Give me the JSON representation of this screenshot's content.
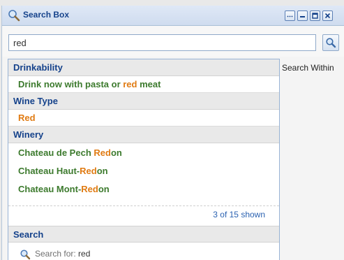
{
  "panel": {
    "title": "Search Box",
    "buttons": [
      "more",
      "minimize",
      "maximize",
      "close"
    ]
  },
  "search": {
    "value": "red",
    "button_icon": "search-icon"
  },
  "side_label": "Search Within",
  "dropdown": {
    "groups": [
      {
        "header": "Drinkability",
        "items": [
          {
            "pre": "Drink now with pasta or ",
            "match": "red",
            "post": " meat"
          }
        ]
      },
      {
        "header": "Wine Type",
        "items": [
          {
            "pre": "",
            "match": "Red",
            "post": ""
          }
        ]
      },
      {
        "header": "Winery",
        "items": [
          {
            "pre": "Chateau de Pech ",
            "match": "Red",
            "post": "on"
          },
          {
            "pre": "Chateau Haut-",
            "match": "Red",
            "post": "on"
          },
          {
            "pre": "Chateau Mont-",
            "match": "Red",
            "post": "on"
          }
        ]
      }
    ],
    "shown_count": "3 of 15 shown",
    "search_header": "Search",
    "search_for_label": "Search for: ",
    "search_for_value": "red"
  },
  "colors": {
    "header_text": "#15428b",
    "item_text": "#3c7a2d",
    "match_text": "#e07b13",
    "link_text": "#2b62b1"
  }
}
